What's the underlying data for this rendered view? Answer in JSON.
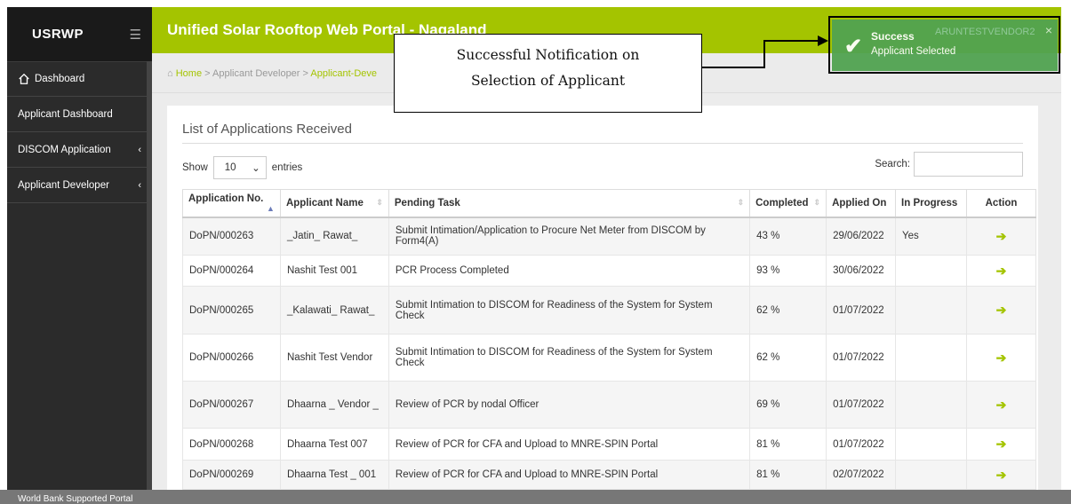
{
  "brand": "USRWP",
  "header": {
    "title": "Unified Solar Rooftop Web Portal - Nagaland"
  },
  "sidebar": {
    "items": [
      {
        "label": "Dashboard"
      },
      {
        "label": "Applicant Dashboard"
      },
      {
        "label": "DISCOM Application"
      },
      {
        "label": "Applicant Developer"
      }
    ]
  },
  "breadcrumb": {
    "home": "Home",
    "sep": ">",
    "level1": "Applicant Developer",
    "level2": "Applicant-Deve"
  },
  "panel": {
    "title": "List of Applications Received"
  },
  "length": {
    "show": "Show",
    "value": "10",
    "entries": "entries"
  },
  "search": {
    "label": "Search:",
    "value": ""
  },
  "table": {
    "headers": [
      "Application No.",
      "Applicant Name",
      "Pending Task",
      "Completed",
      "Applied On",
      "In Progress",
      "Action"
    ],
    "rows": [
      {
        "app_no": "DoPN/000263",
        "name": "_Jatin_ Rawat_",
        "task": "Submit Intimation/Application to Procure Net Meter from DISCOM by Form4(A)",
        "completed": "43 %",
        "applied": "29/06/2022",
        "progress": "Yes"
      },
      {
        "app_no": "DoPN/000264",
        "name": "Nashit Test 001",
        "task": "PCR Process Completed",
        "completed": "93 %",
        "applied": "30/06/2022",
        "progress": ""
      },
      {
        "app_no": "DoPN/000265",
        "name": "_Kalawati_ Rawat_",
        "task": "Submit Intimation to DISCOM for Readiness of the System for System Check",
        "completed": "62 %",
        "applied": "01/07/2022",
        "progress": ""
      },
      {
        "app_no": "DoPN/000266",
        "name": "Nashit Test Vendor",
        "task": "Submit Intimation to DISCOM for Readiness of the System for System Check",
        "completed": "62 %",
        "applied": "01/07/2022",
        "progress": ""
      },
      {
        "app_no": "DoPN/000267",
        "name": "Dhaarna _ Vendor _",
        "task": "Review of PCR by nodal Officer",
        "completed": "69 %",
        "applied": "01/07/2022",
        "progress": ""
      },
      {
        "app_no": "DoPN/000268",
        "name": "Dhaarna Test 007",
        "task": "Review of PCR for CFA and Upload to MNRE-SPIN Portal",
        "completed": "81 %",
        "applied": "01/07/2022",
        "progress": ""
      },
      {
        "app_no": "DoPN/000269",
        "name": "Dhaarna Test _ 001",
        "task": "Review of PCR for CFA and Upload to MNRE-SPIN Portal",
        "completed": "81 %",
        "applied": "02/07/2022",
        "progress": ""
      }
    ]
  },
  "toast": {
    "title": "Success",
    "user": "ARUNTESTVENDOR2",
    "message": "Applicant Selected",
    "close": "×"
  },
  "callout": {
    "line1": "Successful Notification on",
    "line2": "Selection of Applicant"
  },
  "footer": {
    "text": "World Bank Supported Portal"
  },
  "colors": {
    "brand_green": "#a4c400",
    "toast_green": "#51a351",
    "sidebar": "#2b2b2b"
  }
}
